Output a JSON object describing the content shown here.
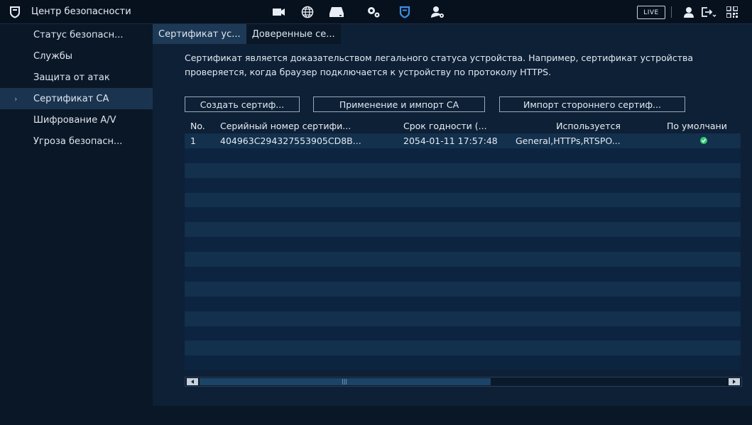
{
  "app": {
    "title": "Центр безопасности",
    "icon": "shield-icon"
  },
  "toolbar": {
    "icons": [
      "camera-icon",
      "network-globe-icon",
      "storage-icon",
      "settings-icon",
      "security-shield-icon",
      "user-settings-icon"
    ],
    "live_label": "LIVE",
    "right_icons": [
      "user-icon",
      "logout-icon",
      "qr-code-icon"
    ]
  },
  "sidebar": {
    "items": [
      {
        "label": "Статус безопасн..."
      },
      {
        "label": "Службы"
      },
      {
        "label": "Защита от атак"
      },
      {
        "label": "Сертификат CA"
      },
      {
        "label": "Шифрование A/V"
      },
      {
        "label": "Угроза безопасн..."
      }
    ],
    "selected": 3
  },
  "tabs": [
    {
      "label": "Сертификат ус..."
    },
    {
      "label": "Доверенные се..."
    }
  ],
  "description": "Сертификат является доказательством легального статуса устройства. Например, сертификат устройства проверяется, когда браузер подключается к устройству по протоколу HTTPS.",
  "buttons": {
    "create": "Создать сертиф...",
    "apply_import": "Применение и импорт CA",
    "import_third": "Импорт стороннего сертиф..."
  },
  "table": {
    "headers": {
      "no": "No.",
      "serial": "Серийный номер сертифи...",
      "expiry": "Срок годности (...",
      "used": "Используется",
      "default": "По умолчани"
    },
    "rows": [
      {
        "no": "1",
        "serial": "404963C294327553905CD8B...",
        "expiry": "2054-01-11 17:57:48",
        "used": "General,HTTPs,RTSPO...",
        "default": true
      }
    ],
    "empty_rows": 15
  },
  "colors": {
    "accent": "#3d8fe0",
    "check": "#2ecc71"
  }
}
